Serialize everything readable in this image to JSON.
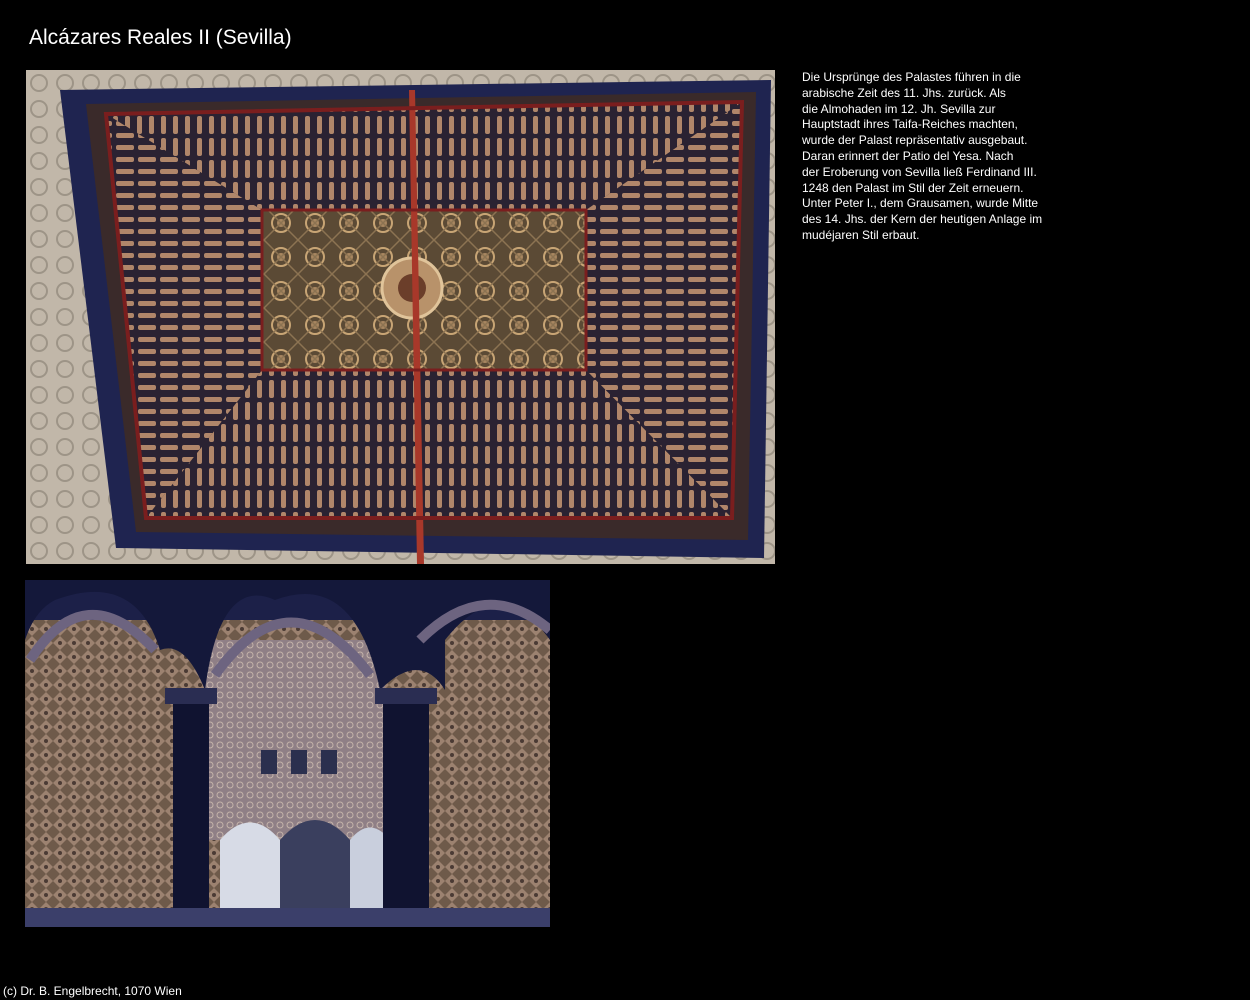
{
  "page": {
    "title": "Alcázares Reales II (Sevilla)"
  },
  "photos": [
    {
      "name": "ceiling-photo",
      "subject": "carved wooden mudejar ceiling with star pattern"
    },
    {
      "name": "arches-photo",
      "subject": "horseshoe arches with stucco decoration, Patio de las Doncellas"
    }
  ],
  "description": {
    "lines": [
      "Die Ursprünge des Palastes führen in die",
      "arabische Zeit des 11. Jhs. zurück. Als",
      "die Almohaden im 12. Jh. Sevilla zur",
      "Hauptstadt ihres Taifa-Reiches machten,",
      "wurde der Palast repräsentativ ausgebaut.",
      "Daran erinnert der Patio del Yesa. Nach",
      "der Eroberung von Sevilla ließ Ferdinand III.",
      "1248 den Palast im Stil der Zeit erneuern.",
      "Unter Peter I., dem Grausamen, wurde Mitte",
      "des 14. Jhs. der Kern der heutigen Anlage im",
      "mudéjaren Stil erbaut."
    ]
  },
  "footer": {
    "copyright": "(c) Dr. B. Engelbrecht, 1070 Wien"
  },
  "colors": {
    "background": "#000000",
    "text": "#ffffff"
  }
}
